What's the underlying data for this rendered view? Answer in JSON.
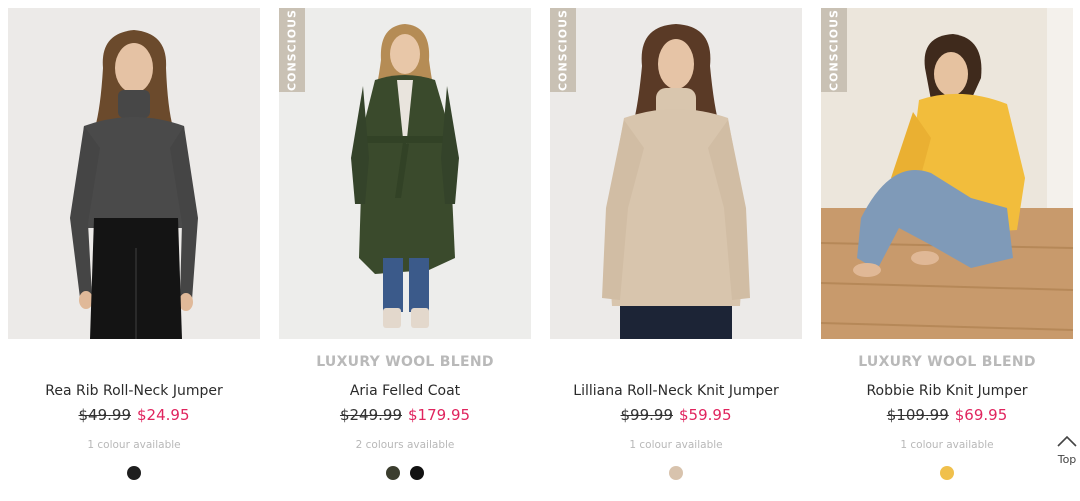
{
  "products": [
    {
      "badge": "",
      "tag": "",
      "name": "Rea Rib Roll-Neck Jumper",
      "was_price": "$49.99",
      "now_price": "$24.95",
      "colours_text": "1 colour available",
      "swatches": [
        "#1e1e1e"
      ]
    },
    {
      "badge": "CONSCIOUS",
      "tag": "LUXURY WOOL BLEND",
      "name": "Aria Felled Coat",
      "was_price": "$249.99",
      "now_price": "$179.95",
      "colours_text": "2 colours available",
      "swatches": [
        "#3b3d2e",
        "#111111"
      ]
    },
    {
      "badge": "CONSCIOUS",
      "tag": "",
      "name": "Lilliana Roll-Neck Knit Jumper",
      "was_price": "$99.99",
      "now_price": "$59.95",
      "colours_text": "1 colour available",
      "swatches": [
        "#d8c3ad"
      ]
    },
    {
      "badge": "CONSCIOUS",
      "tag": "LUXURY WOOL BLEND",
      "name": "Robbie Rib Knit Jumper",
      "was_price": "$109.99",
      "now_price": "$69.95",
      "colours_text": "1 colour available",
      "swatches": [
        "#f0c04c"
      ]
    }
  ],
  "back_to_top": {
    "label": "Top",
    "icon": "chevron-up-icon"
  },
  "colors": {
    "sale_price": "#e0245e",
    "badge_bg": "#c9c1b4"
  }
}
